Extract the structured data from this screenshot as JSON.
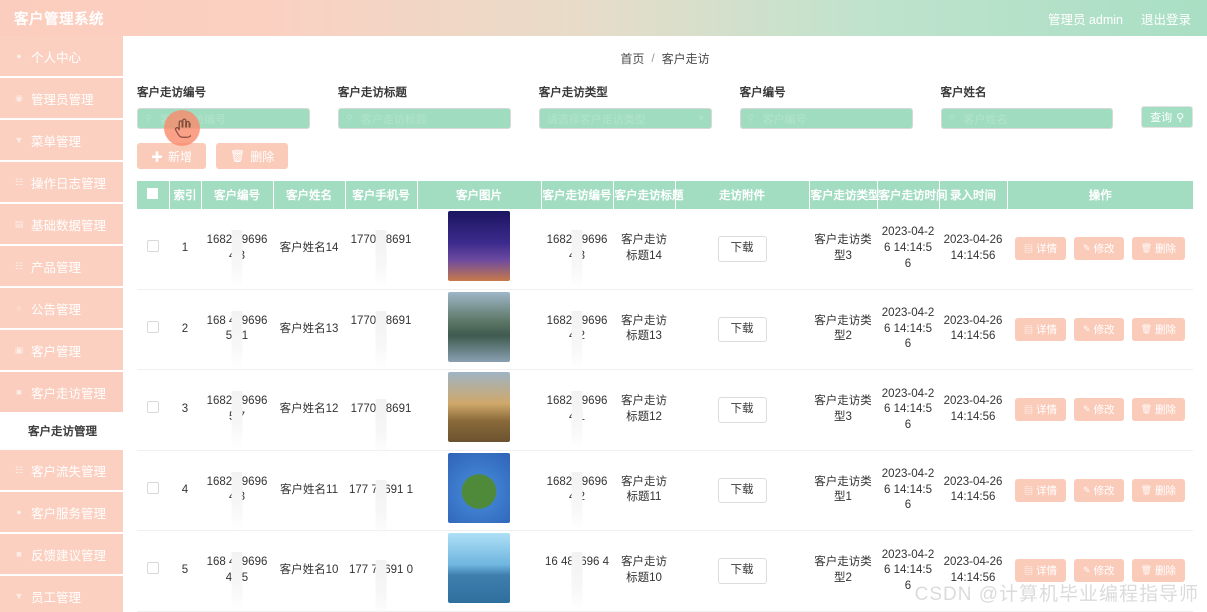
{
  "app": {
    "title": "客户管理系统",
    "admin_label": "管理员 admin",
    "logout_label": "退出登录"
  },
  "sidebar": {
    "items": [
      {
        "label": "个人中心",
        "icon": "user-icon"
      },
      {
        "label": "管理员管理",
        "icon": "circle-icon"
      },
      {
        "label": "菜单管理",
        "icon": "menu-icon"
      },
      {
        "label": "操作日志管理",
        "icon": "log-icon"
      },
      {
        "label": "基础数据管理",
        "icon": "database-icon"
      },
      {
        "label": "产品管理",
        "icon": "box-icon"
      },
      {
        "label": "公告管理",
        "icon": "bell-icon"
      },
      {
        "label": "客户管理",
        "icon": "people-icon"
      },
      {
        "label": "客户走访管理",
        "icon": "visit-icon"
      }
    ],
    "active_sub": "客户走访管理",
    "items_after": [
      {
        "label": "客户流失管理",
        "icon": "chart-icon"
      },
      {
        "label": "客户服务管理",
        "icon": "service-icon"
      },
      {
        "label": "反馈建议管理",
        "icon": "feedback-icon"
      },
      {
        "label": "员工管理",
        "icon": "staff-icon"
      }
    ]
  },
  "breadcrumb": {
    "home": "首页",
    "separator": "/",
    "current": "客户走访"
  },
  "filters": [
    {
      "label": "客户走访编号",
      "placeholder": "客户走访编号",
      "value": "",
      "type": "search"
    },
    {
      "label": "客户走访标题",
      "placeholder": "客户走访标题",
      "value": "",
      "type": "search"
    },
    {
      "label": "客户走访类型",
      "placeholder": "请选择客户走访类型",
      "value": "",
      "type": "select"
    },
    {
      "label": "客户编号",
      "placeholder": "客户编号",
      "value": "",
      "type": "search"
    },
    {
      "label": "客户姓名",
      "placeholder": "客户姓名",
      "value": "",
      "type": "search"
    }
  ],
  "query_button": {
    "label": "查询",
    "icon": "search-icon"
  },
  "toolbar": {
    "add_label": "新增",
    "add_icon": "plus-icon",
    "delete_label": "删除",
    "delete_icon": "trash-icon"
  },
  "table": {
    "columns": [
      "索引",
      "客户编号",
      "客户姓名",
      "客户手机号",
      "客户图片",
      "客户走访编号",
      "客户走访标题",
      "走访附件",
      "客户走访类型",
      "客户走访时间",
      "录入时间",
      "操作"
    ],
    "download_label": "下载",
    "row_actions": [
      {
        "label": "详情",
        "icon": "detail-icon"
      },
      {
        "label": "修改",
        "icon": "edit-icon"
      },
      {
        "label": "删除",
        "icon": "trash-icon"
      }
    ],
    "rows": [
      {
        "index": "1",
        "customer_no": "1682 896964 3",
        "customer_name": "客户姓名14",
        "phone": "1770 78691 1",
        "image": "eiffel-tower",
        "visit_no": "1682 39696 4 3",
        "visit_title": "客户走访标题14",
        "attachment": "下载",
        "visit_type": "客户走访类型3",
        "visit_time": "2023-04-26 14:14:56",
        "entry_time": "2023-04-26 14:14:56"
      },
      {
        "index": "2",
        "customer_no": "168 4896965 01",
        "customer_name": "客户姓名13",
        "phone": "1770 78691 1",
        "image": "lake-village",
        "visit_no": "1682 39696 4 2",
        "visit_title": "客户走访标题13",
        "attachment": "下载",
        "visit_type": "客户走访类型2",
        "visit_time": "2023-04-26 14:14:56",
        "entry_time": "2023-04-26 14:14:56"
      },
      {
        "index": "3",
        "customer_no": "1682 896965 7",
        "customer_name": "客户姓名12",
        "phone": "1770 78691",
        "image": "desert-sunset",
        "visit_no": "1682 39696 4 1",
        "visit_title": "客户走访标题12",
        "attachment": "下载",
        "visit_type": "客户走访类型3",
        "visit_time": "2023-04-26 14:14:56",
        "entry_time": "2023-04-26 14:14:56"
      },
      {
        "index": "4",
        "customer_no": "1682 896964 8",
        "customer_name": "客户姓名11",
        "phone": "177 78691 1",
        "image": "tiny-planet",
        "visit_no": "1682 39696 4 2",
        "visit_title": "客户走访标题11",
        "attachment": "下载",
        "visit_type": "客户走访类型1",
        "visit_time": "2023-04-26 14:14:56",
        "entry_time": "2023-04-26 14:14:56"
      },
      {
        "index": "5",
        "customer_no": "168 4896964 35",
        "customer_name": "客户姓名10",
        "phone": "177 78691 0",
        "image": "blue-lake",
        "visit_no": "16 489696 43",
        "visit_title": "客户走访标题10",
        "attachment": "下载",
        "visit_type": "客户走访类型2",
        "visit_time": "2023-04-26 14:14:56",
        "entry_time": "2023-04-26 14:14:56"
      }
    ]
  },
  "watermark": "CSDN @计算机毕业编程指导师",
  "colors": {
    "pink": "#fbd0c1",
    "pink_button": "#fbcbba",
    "green": "#a2ddc2",
    "green_input": "#9fdcc0",
    "cursor": "#f98d6e"
  }
}
